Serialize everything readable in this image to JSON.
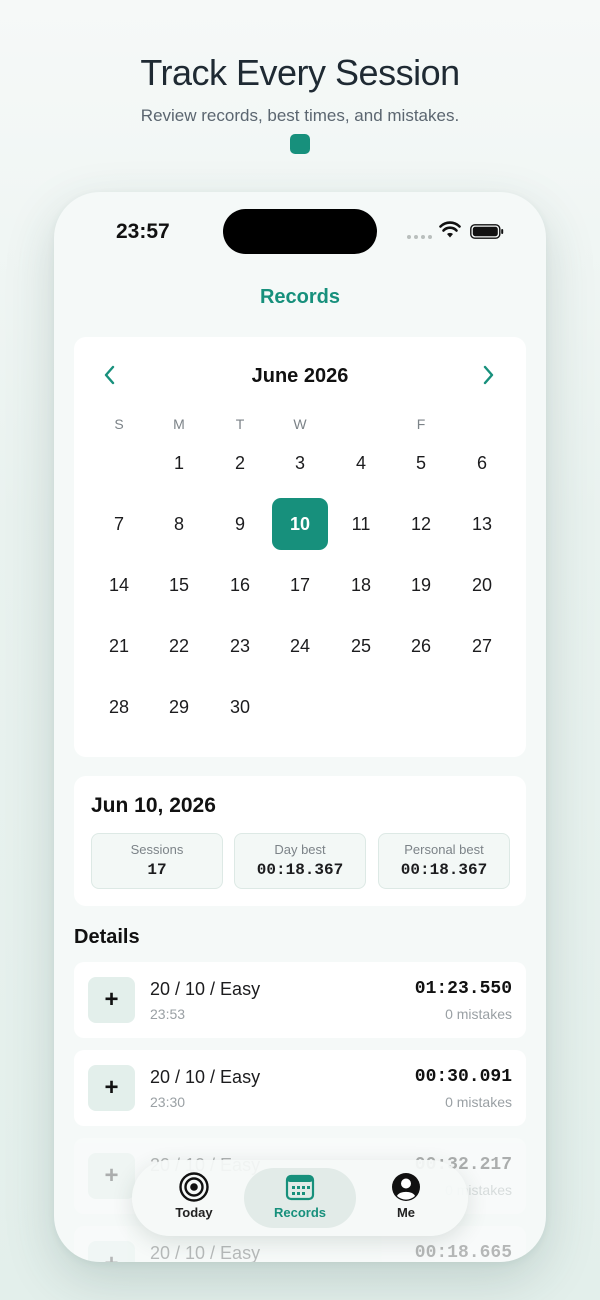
{
  "hero": {
    "title": "Track Every Session",
    "subtitle": "Review records, best times, and mistakes."
  },
  "status_bar": {
    "time": "23:57"
  },
  "nav": {
    "title": "Records"
  },
  "calendar": {
    "month_label": "June 2026",
    "weekdays": [
      "S",
      "M",
      "T",
      "W",
      "",
      "F",
      ""
    ],
    "days": [
      "1",
      "2",
      "3",
      "4",
      "5",
      "6",
      "7",
      "8",
      "9",
      "10",
      "11",
      "12",
      "13",
      "14",
      "15",
      "16",
      "17",
      "18",
      "19",
      "20",
      "21",
      "22",
      "23",
      "24",
      "25",
      "26",
      "27",
      "28",
      "29",
      "30"
    ],
    "selected_day": "10"
  },
  "summary": {
    "date": "Jun 10, 2026",
    "stats": [
      {
        "label": "Sessions",
        "value": "17"
      },
      {
        "label": "Day best",
        "value": "00:18.367"
      },
      {
        "label": "Personal best",
        "value": "00:18.367"
      }
    ]
  },
  "details": {
    "title": "Details",
    "records": [
      {
        "title": "20 / 10 / Easy",
        "time": "23:53",
        "duration": "01:23.550",
        "mistakes": "0 mistakes"
      },
      {
        "title": "20 / 10 / Easy",
        "time": "23:30",
        "duration": "00:30.091",
        "mistakes": "0 mistakes"
      },
      {
        "title": "20 / 10 / Easy",
        "time": "",
        "duration": "00:32.217",
        "mistakes": "0 mistakes"
      },
      {
        "title": "20 / 10 / Easy",
        "time": "",
        "duration": "00:18.665",
        "mistakes": ""
      }
    ]
  },
  "tabbar": {
    "tabs": [
      {
        "label": "Today",
        "icon": "target-icon"
      },
      {
        "label": "Records",
        "icon": "calendar-icon",
        "active": true
      },
      {
        "label": "Me",
        "icon": "person-icon"
      }
    ]
  },
  "colors": {
    "accent": "#17907c",
    "tint": "#e3efeb"
  }
}
